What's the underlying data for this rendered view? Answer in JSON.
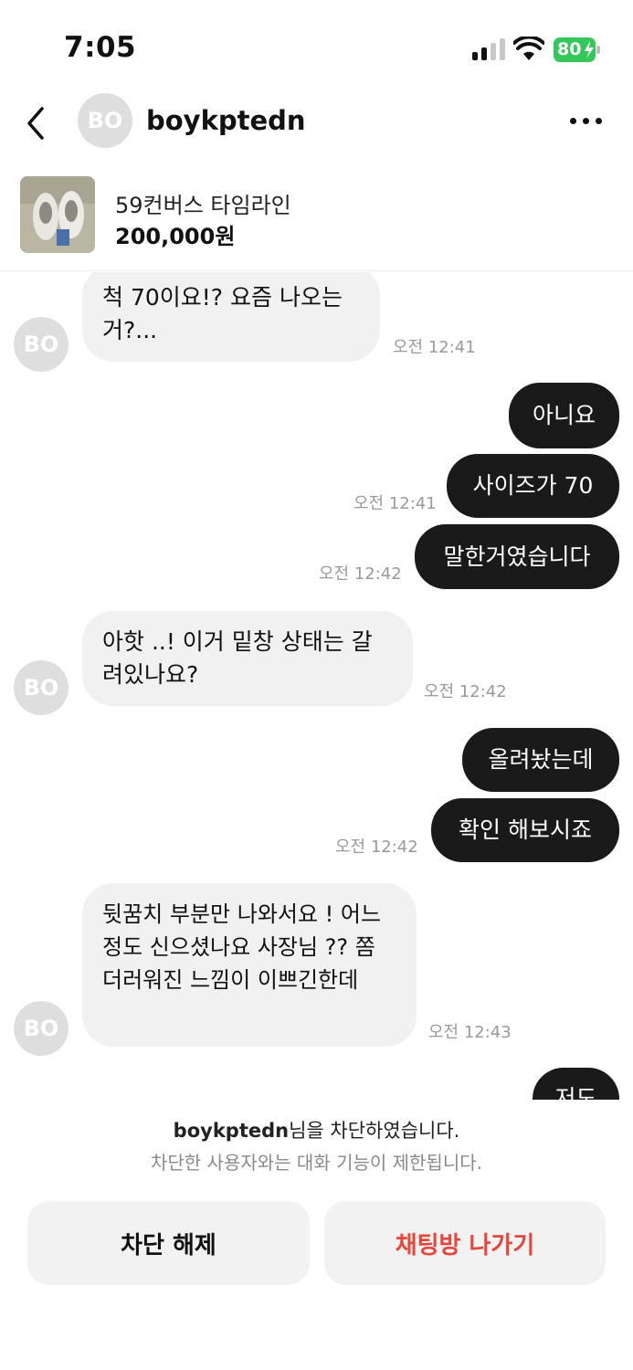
{
  "status_bar": {
    "time": "7:05",
    "battery": "80"
  },
  "header": {
    "avatar_initials": "BO",
    "username": "boykptedn"
  },
  "product": {
    "title": "59컨버스 타임라인",
    "price": "200,000원"
  },
  "messages": [
    {
      "dir": "in",
      "text": "척 70이요!? 요즘 나오는 거?...",
      "time": "오전 12:41"
    },
    {
      "dir": "out",
      "text": "아니요"
    },
    {
      "dir": "out",
      "text": "사이즈가 70",
      "time": "오전 12:41"
    },
    {
      "dir": "out",
      "text": "말한거였습니다",
      "time": "오전 12:42"
    },
    {
      "dir": "in",
      "text": "아핫 ..! 이거 밑창 상태는 갈려있나요?",
      "time": "오전 12:42"
    },
    {
      "dir": "out",
      "text": "올려놨는데"
    },
    {
      "dir": "out",
      "text": "확인 해보시죠",
      "time": "오전 12:42"
    },
    {
      "dir": "in",
      "text": "뒷꿈치 부분만 나와서요 ! 어느정도 신으셨나요 사장님 ?? 쫌 더러워진 느낌이 이쁘긴한데",
      "time": "오전 12:43"
    },
    {
      "dir": "out",
      "text": "저도"
    }
  ],
  "blocked": {
    "username": "boykptedn",
    "message_suffix": "님을 차단하였습니다.",
    "sub_message": "차단한 사용자와는 대화 기능이 제한됩니다.",
    "unblock_label": "차단 해제",
    "leave_label": "채팅방 나가기"
  },
  "colors": {
    "outgoing_bubble": "#1a1a1a",
    "incoming_bubble": "#f1f1f1",
    "leave_button_text": "#e8453c",
    "battery_fill": "#34c759"
  }
}
